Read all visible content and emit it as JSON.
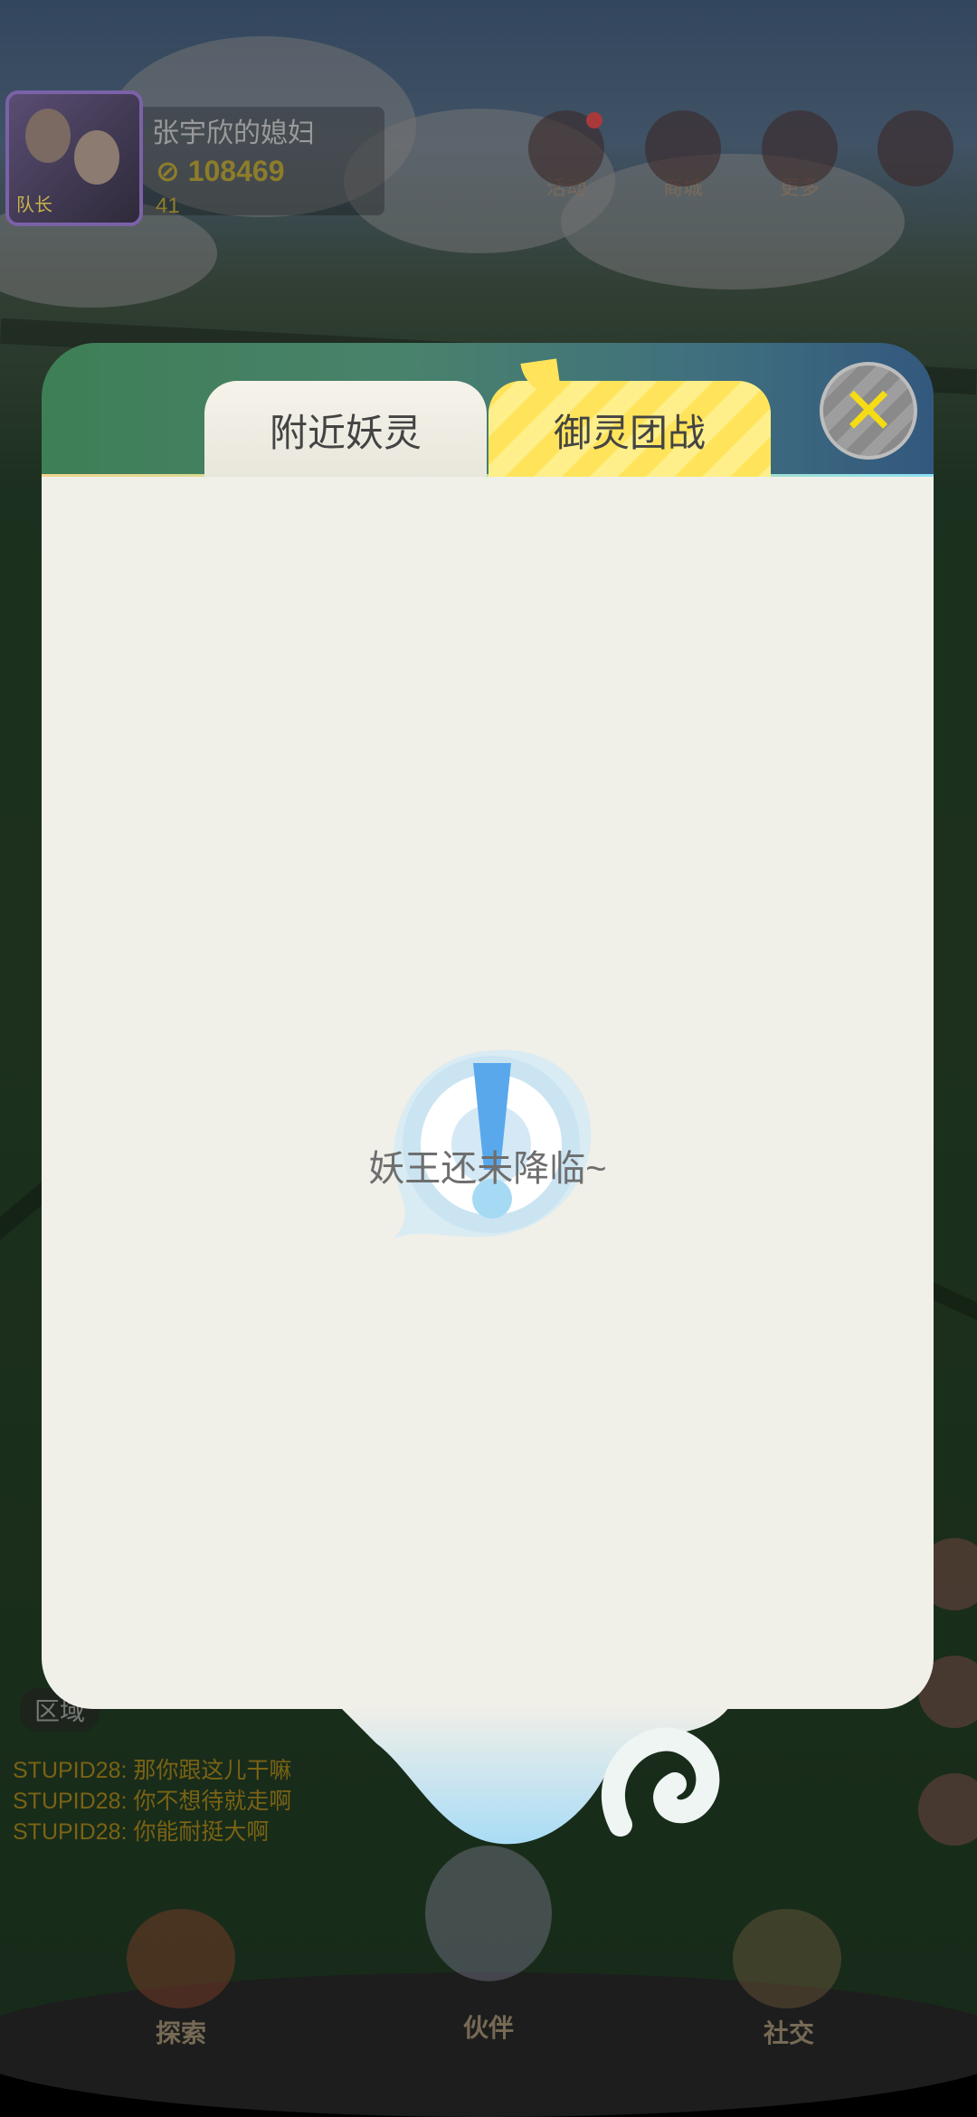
{
  "player": {
    "name": "张宇欣的媳妇",
    "score": "108469",
    "level": "41",
    "role_badge": "队长"
  },
  "top_buttons": [
    {
      "label": "活动",
      "icon": "gift-icon",
      "badge": true
    },
    {
      "label": "商城",
      "icon": "shop-icon",
      "badge": false
    },
    {
      "label": "更多",
      "icon": "grid-icon",
      "badge": false
    },
    {
      "label": "",
      "icon": "compass-icon",
      "badge": false
    }
  ],
  "chat": {
    "tab_label": "区域",
    "messages": [
      "STUPID28: 那你跟这儿干嘛",
      "STUPID28: 你不想待就走啊",
      "STUPID28: 你能耐挺大啊"
    ]
  },
  "bottom_nav": {
    "explore": "探索",
    "partner": "伙伴",
    "social": "社交"
  },
  "modal": {
    "tabs": [
      {
        "label": "附近妖灵",
        "active": false
      },
      {
        "label": "御灵团战",
        "active": true
      }
    ],
    "empty_message": "妖王还未降临~",
    "colors": {
      "active_tab": "#ffe45b",
      "body": "#f0efe8",
      "close_x": "#f6dc14"
    }
  }
}
